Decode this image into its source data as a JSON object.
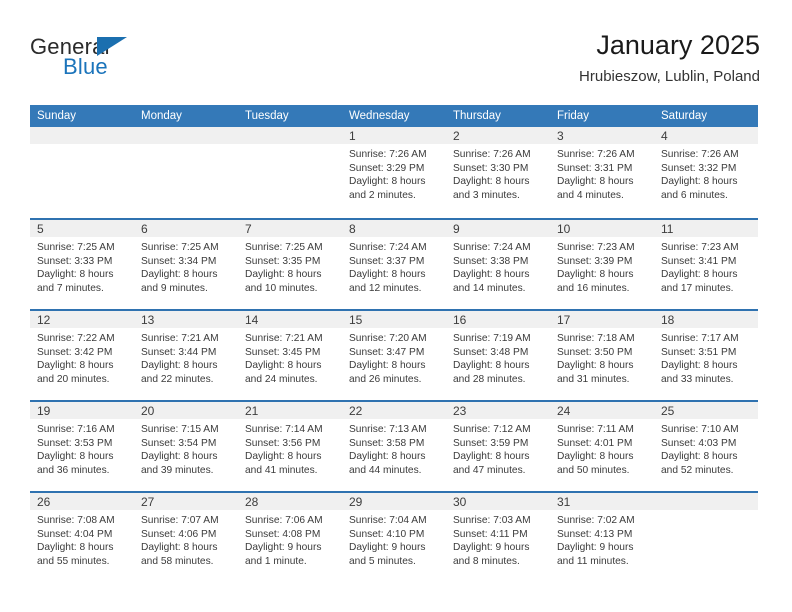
{
  "logo": {
    "word_one": "General",
    "word_two": "Blue",
    "triangle_color": "#1b6faf",
    "blue_color": "#1b74bb"
  },
  "header": {
    "title": "January 2025",
    "subtitle": "Hrubieszow, Lublin, Poland"
  },
  "theme": {
    "header_row_bg": "#3479b8",
    "week_divider": "#2f72b0",
    "day_strip_bg": "#f0f0f0",
    "text": "#3b3b3b"
  },
  "weekdays": [
    "Sunday",
    "Monday",
    "Tuesday",
    "Wednesday",
    "Thursday",
    "Friday",
    "Saturday"
  ],
  "weeks": [
    [
      {
        "day": "",
        "lines": []
      },
      {
        "day": "",
        "lines": []
      },
      {
        "day": "",
        "lines": []
      },
      {
        "day": "1",
        "lines": [
          "Sunrise: 7:26 AM",
          "Sunset: 3:29 PM",
          "Daylight: 8 hours",
          "and 2 minutes."
        ]
      },
      {
        "day": "2",
        "lines": [
          "Sunrise: 7:26 AM",
          "Sunset: 3:30 PM",
          "Daylight: 8 hours",
          "and 3 minutes."
        ]
      },
      {
        "day": "3",
        "lines": [
          "Sunrise: 7:26 AM",
          "Sunset: 3:31 PM",
          "Daylight: 8 hours",
          "and 4 minutes."
        ]
      },
      {
        "day": "4",
        "lines": [
          "Sunrise: 7:26 AM",
          "Sunset: 3:32 PM",
          "Daylight: 8 hours",
          "and 6 minutes."
        ]
      }
    ],
    [
      {
        "day": "5",
        "lines": [
          "Sunrise: 7:25 AM",
          "Sunset: 3:33 PM",
          "Daylight: 8 hours",
          "and 7 minutes."
        ]
      },
      {
        "day": "6",
        "lines": [
          "Sunrise: 7:25 AM",
          "Sunset: 3:34 PM",
          "Daylight: 8 hours",
          "and 9 minutes."
        ]
      },
      {
        "day": "7",
        "lines": [
          "Sunrise: 7:25 AM",
          "Sunset: 3:35 PM",
          "Daylight: 8 hours",
          "and 10 minutes."
        ]
      },
      {
        "day": "8",
        "lines": [
          "Sunrise: 7:24 AM",
          "Sunset: 3:37 PM",
          "Daylight: 8 hours",
          "and 12 minutes."
        ]
      },
      {
        "day": "9",
        "lines": [
          "Sunrise: 7:24 AM",
          "Sunset: 3:38 PM",
          "Daylight: 8 hours",
          "and 14 minutes."
        ]
      },
      {
        "day": "10",
        "lines": [
          "Sunrise: 7:23 AM",
          "Sunset: 3:39 PM",
          "Daylight: 8 hours",
          "and 16 minutes."
        ]
      },
      {
        "day": "11",
        "lines": [
          "Sunrise: 7:23 AM",
          "Sunset: 3:41 PM",
          "Daylight: 8 hours",
          "and 17 minutes."
        ]
      }
    ],
    [
      {
        "day": "12",
        "lines": [
          "Sunrise: 7:22 AM",
          "Sunset: 3:42 PM",
          "Daylight: 8 hours",
          "and 20 minutes."
        ]
      },
      {
        "day": "13",
        "lines": [
          "Sunrise: 7:21 AM",
          "Sunset: 3:44 PM",
          "Daylight: 8 hours",
          "and 22 minutes."
        ]
      },
      {
        "day": "14",
        "lines": [
          "Sunrise: 7:21 AM",
          "Sunset: 3:45 PM",
          "Daylight: 8 hours",
          "and 24 minutes."
        ]
      },
      {
        "day": "15",
        "lines": [
          "Sunrise: 7:20 AM",
          "Sunset: 3:47 PM",
          "Daylight: 8 hours",
          "and 26 minutes."
        ]
      },
      {
        "day": "16",
        "lines": [
          "Sunrise: 7:19 AM",
          "Sunset: 3:48 PM",
          "Daylight: 8 hours",
          "and 28 minutes."
        ]
      },
      {
        "day": "17",
        "lines": [
          "Sunrise: 7:18 AM",
          "Sunset: 3:50 PM",
          "Daylight: 8 hours",
          "and 31 minutes."
        ]
      },
      {
        "day": "18",
        "lines": [
          "Sunrise: 7:17 AM",
          "Sunset: 3:51 PM",
          "Daylight: 8 hours",
          "and 33 minutes."
        ]
      }
    ],
    [
      {
        "day": "19",
        "lines": [
          "Sunrise: 7:16 AM",
          "Sunset: 3:53 PM",
          "Daylight: 8 hours",
          "and 36 minutes."
        ]
      },
      {
        "day": "20",
        "lines": [
          "Sunrise: 7:15 AM",
          "Sunset: 3:54 PM",
          "Daylight: 8 hours",
          "and 39 minutes."
        ]
      },
      {
        "day": "21",
        "lines": [
          "Sunrise: 7:14 AM",
          "Sunset: 3:56 PM",
          "Daylight: 8 hours",
          "and 41 minutes."
        ]
      },
      {
        "day": "22",
        "lines": [
          "Sunrise: 7:13 AM",
          "Sunset: 3:58 PM",
          "Daylight: 8 hours",
          "and 44 minutes."
        ]
      },
      {
        "day": "23",
        "lines": [
          "Sunrise: 7:12 AM",
          "Sunset: 3:59 PM",
          "Daylight: 8 hours",
          "and 47 minutes."
        ]
      },
      {
        "day": "24",
        "lines": [
          "Sunrise: 7:11 AM",
          "Sunset: 4:01 PM",
          "Daylight: 8 hours",
          "and 50 minutes."
        ]
      },
      {
        "day": "25",
        "lines": [
          "Sunrise: 7:10 AM",
          "Sunset: 4:03 PM",
          "Daylight: 8 hours",
          "and 52 minutes."
        ]
      }
    ],
    [
      {
        "day": "26",
        "lines": [
          "Sunrise: 7:08 AM",
          "Sunset: 4:04 PM",
          "Daylight: 8 hours",
          "and 55 minutes."
        ]
      },
      {
        "day": "27",
        "lines": [
          "Sunrise: 7:07 AM",
          "Sunset: 4:06 PM",
          "Daylight: 8 hours",
          "and 58 minutes."
        ]
      },
      {
        "day": "28",
        "lines": [
          "Sunrise: 7:06 AM",
          "Sunset: 4:08 PM",
          "Daylight: 9 hours",
          "and 1 minute."
        ]
      },
      {
        "day": "29",
        "lines": [
          "Sunrise: 7:04 AM",
          "Sunset: 4:10 PM",
          "Daylight: 9 hours",
          "and 5 minutes."
        ]
      },
      {
        "day": "30",
        "lines": [
          "Sunrise: 7:03 AM",
          "Sunset: 4:11 PM",
          "Daylight: 9 hours",
          "and 8 minutes."
        ]
      },
      {
        "day": "31",
        "lines": [
          "Sunrise: 7:02 AM",
          "Sunset: 4:13 PM",
          "Daylight: 9 hours",
          "and 11 minutes."
        ]
      },
      {
        "day": "",
        "lines": []
      }
    ]
  ]
}
